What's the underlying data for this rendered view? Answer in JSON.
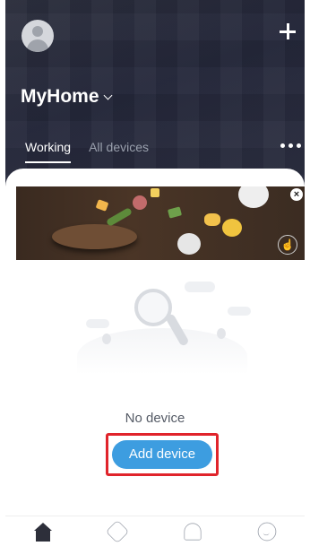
{
  "header": {
    "home_name": "MyHome",
    "tabs": [
      {
        "label": "Working",
        "active": true
      },
      {
        "label": "All devices",
        "active": false
      }
    ]
  },
  "banner": {
    "close_symbol": "×"
  },
  "empty_state": {
    "message": "No device",
    "button_label": "Add device",
    "highlight_color": "#e0242b",
    "button_color": "#3d9de0"
  },
  "tabbar": {
    "items": [
      {
        "icon": "home-icon",
        "active": true
      },
      {
        "icon": "hexagon-icon",
        "active": false
      },
      {
        "icon": "bell-icon",
        "active": false
      },
      {
        "icon": "smile-icon",
        "active": false
      }
    ]
  }
}
